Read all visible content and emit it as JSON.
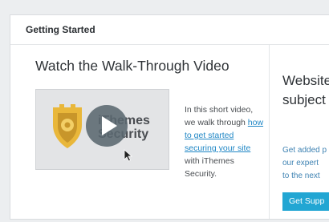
{
  "panel": {
    "title": "Getting Started"
  },
  "video_section": {
    "title": "Watch the Walk-Through Video",
    "thumbnail": {
      "brand_line1": "iThemes",
      "brand_line2": "Security"
    },
    "desc_before": "In this short video, we walk through ",
    "desc_link": "how to get started securing your site",
    "desc_after": " with iThemes Security."
  },
  "support_section": {
    "title": "Website subject help.",
    "desc_line1": "Get added p",
    "desc_line2": "our expert",
    "desc_line3": "to the next",
    "button_label": "Get Supp"
  },
  "colors": {
    "accent": "#22a6d3",
    "link": "#1e86c5",
    "shield_gold": "#e9b73a"
  },
  "icons": [
    "shield-icon",
    "play-icon",
    "cursor-icon"
  ]
}
